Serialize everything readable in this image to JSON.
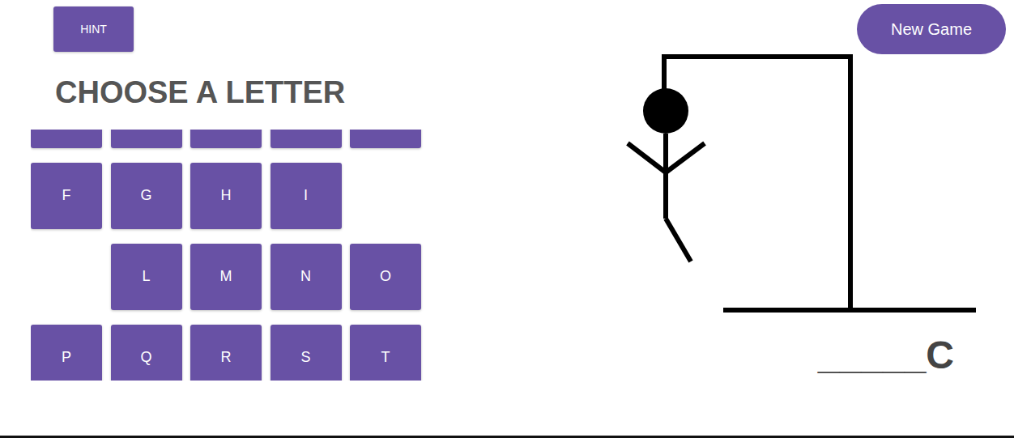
{
  "hint_button": "HINT",
  "new_game_button": "New Game",
  "heading": "CHOOSE A LETTER",
  "letters": [
    {
      "letter": "",
      "used": false
    },
    {
      "letter": "",
      "used": false
    },
    {
      "letter": "",
      "used": false
    },
    {
      "letter": "",
      "used": false
    },
    {
      "letter": "",
      "used": false
    },
    {
      "letter": "F",
      "used": false
    },
    {
      "letter": "G",
      "used": false
    },
    {
      "letter": "H",
      "used": false
    },
    {
      "letter": "I",
      "used": false
    },
    {
      "letter": "",
      "used": true
    },
    {
      "letter": "",
      "used": true
    },
    {
      "letter": "L",
      "used": false
    },
    {
      "letter": "M",
      "used": false
    },
    {
      "letter": "N",
      "used": false
    },
    {
      "letter": "O",
      "used": false
    },
    {
      "letter": "P",
      "used": false
    },
    {
      "letter": "Q",
      "used": false
    },
    {
      "letter": "R",
      "used": false
    },
    {
      "letter": "S",
      "used": false
    },
    {
      "letter": "T",
      "used": false
    }
  ],
  "figure": {
    "head": true,
    "body": true,
    "left_arm": true,
    "right_arm": true,
    "left_leg": false,
    "right_leg": true
  },
  "word": "_____C"
}
